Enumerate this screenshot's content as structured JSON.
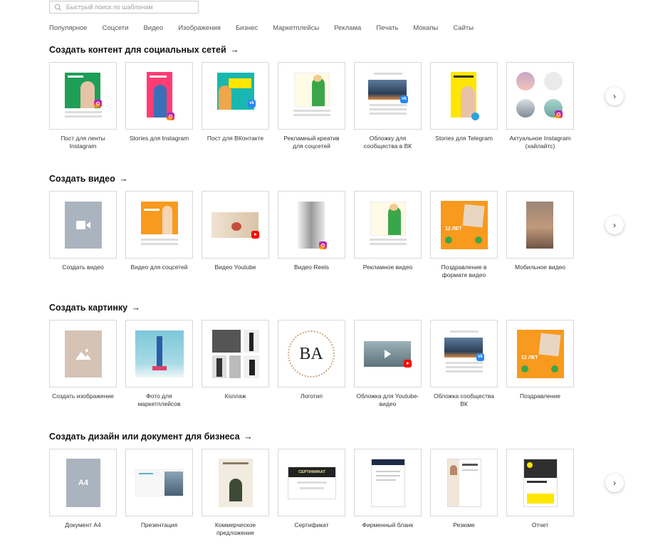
{
  "search": {
    "placeholder": "Быстрый поиск по шаблонам"
  },
  "categories": [
    "Популярное",
    "Соцсети",
    "Видео",
    "Изображения",
    "Бизнес",
    "Маркетплейсы",
    "Реклама",
    "Печать",
    "Мокапы",
    "Сайты"
  ],
  "sections": [
    {
      "title": "Создать контент для социальных сетей",
      "arrow": "→",
      "items": [
        "Пост для ленты Instagram",
        "Stories для Instagram",
        "Пост для ВКонтакте",
        "Рекламный креатив для соцсетей",
        "Обложку для сообщества в ВК",
        "Stories для Telegram",
        "Актуальное Instagram (хайлайтс)"
      ]
    },
    {
      "title": "Создать видео",
      "arrow": "→",
      "items": [
        "Создать видео",
        "Видео для соцсетей",
        "Видео Youtube",
        "Видео Reels",
        "Рекламное видео",
        "Поздравление в формате видео",
        "Мобильное видео"
      ]
    },
    {
      "title": "Создать картинку",
      "arrow": "→",
      "items": [
        "Создать изображение",
        "Фото для маркетплейсов",
        "Коллаж",
        "Логотип",
        "Обложка для Youtube-видео",
        "Обложка сообщества ВК",
        "Поздравление"
      ]
    },
    {
      "title": "Создать дизайн или документ для бизнеса",
      "arrow": "→",
      "items": [
        "Документ А4",
        "Презентация",
        "Коммерческое предложение",
        "Сертификат",
        "Фирменный бланк",
        "Резюме",
        "Отчет"
      ]
    }
  ],
  "thumb_text": {
    "a4": "A4",
    "vk": "vk",
    "age": "12 ЛЕТ",
    "cert": "СЕРТИФИКАТ",
    "logo_initials": "BA"
  },
  "next_label": "›",
  "colors": {
    "green": "#1f9e57",
    "pink": "#ff3d74",
    "teal": "#19b7b0",
    "yellow": "#ffe600",
    "orange": "#f79a1d",
    "grey": "#aab4bf",
    "beige": "#d5c3b6"
  }
}
